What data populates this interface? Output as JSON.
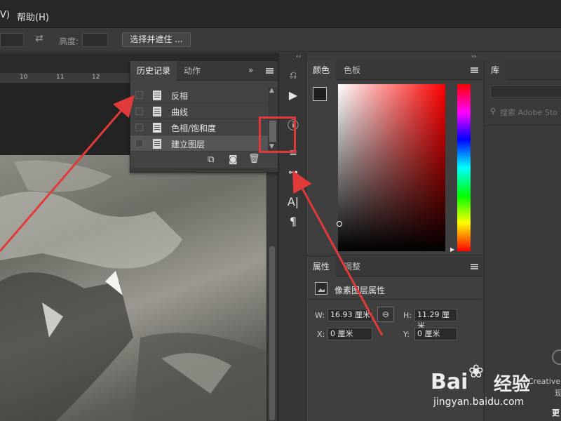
{
  "menubar": {
    "frag": "V)",
    "help": "帮助(H)"
  },
  "options": {
    "height_label": "高度:",
    "select_mask_button": "选择并遮住 ..."
  },
  "ruler": {
    "ticks": [
      "10",
      "11",
      "12"
    ]
  },
  "history_panel": {
    "tab_history": "历史记录",
    "tab_actions": "动作",
    "items": [
      "反相",
      "曲线",
      "色相/饱和度",
      "建立图层"
    ]
  },
  "color_panel": {
    "tab_color": "颜色",
    "tab_swatches": "色板",
    "foreground": "#1e1e1e",
    "background": "#7d9f74"
  },
  "properties_panel": {
    "tab_properties": "属性",
    "tab_adjustments": "调整",
    "type_label": "像素图层属性",
    "w_label": "W:",
    "w_value": "16.93 厘米",
    "h_label": "H:",
    "h_value": "11.29 厘米",
    "x_label": "X:",
    "x_value": "0 厘米",
    "y_label": "Y:",
    "y_value": "0 厘米"
  },
  "library_panel": {
    "tab_library": "库",
    "search_placeholder": "搜索 Adobe Sto",
    "creative_text": "Creative",
    "fragment_1": "现",
    "fragment_2": "更"
  },
  "watermark": {
    "site": "jingyan.baidu.com",
    "brand_left": "Bai",
    "brand_right": "经验"
  },
  "colors": {
    "annotation_red": "#e03a3a"
  }
}
